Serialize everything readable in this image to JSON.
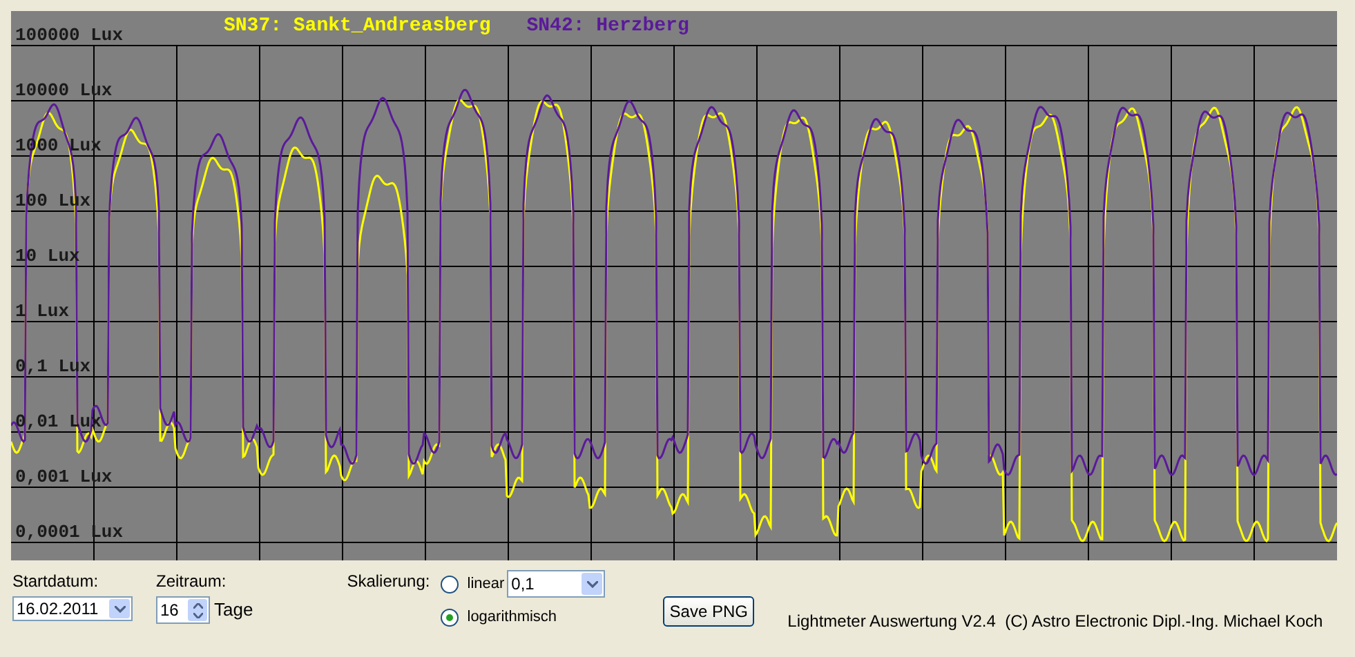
{
  "chart": {
    "legend": [
      {
        "label": "SN37: Sankt_Andreasberg",
        "color": "#ffff00"
      },
      {
        "label": "SN42: Herzberg",
        "color": "#5a1a9a"
      }
    ],
    "y_labels": [
      "100000 Lux",
      "10000 Lux",
      "1000 Lux",
      "100 Lux",
      "10 Lux",
      "1 Lux",
      "0,1 Lux",
      "0,01 Lux",
      "0,001 Lux",
      "0,0001 Lux"
    ]
  },
  "controls": {
    "start_date": {
      "label": "Startdatum:",
      "value": "16.02.2011"
    },
    "period": {
      "label": "Zeitraum:",
      "value": "16",
      "unit": "Tage"
    },
    "scaling": {
      "label": "Skalierung:",
      "options": [
        {
          "label": "linear",
          "selected": false
        },
        {
          "label": "logarithmisch",
          "selected": true
        }
      ],
      "linear_factor": "0,1"
    },
    "save_button": "Save PNG",
    "credits": "Lightmeter Auswertung V2.4  (C) Astro Electronic Dipl.-Ing. Michael Koch"
  }
}
